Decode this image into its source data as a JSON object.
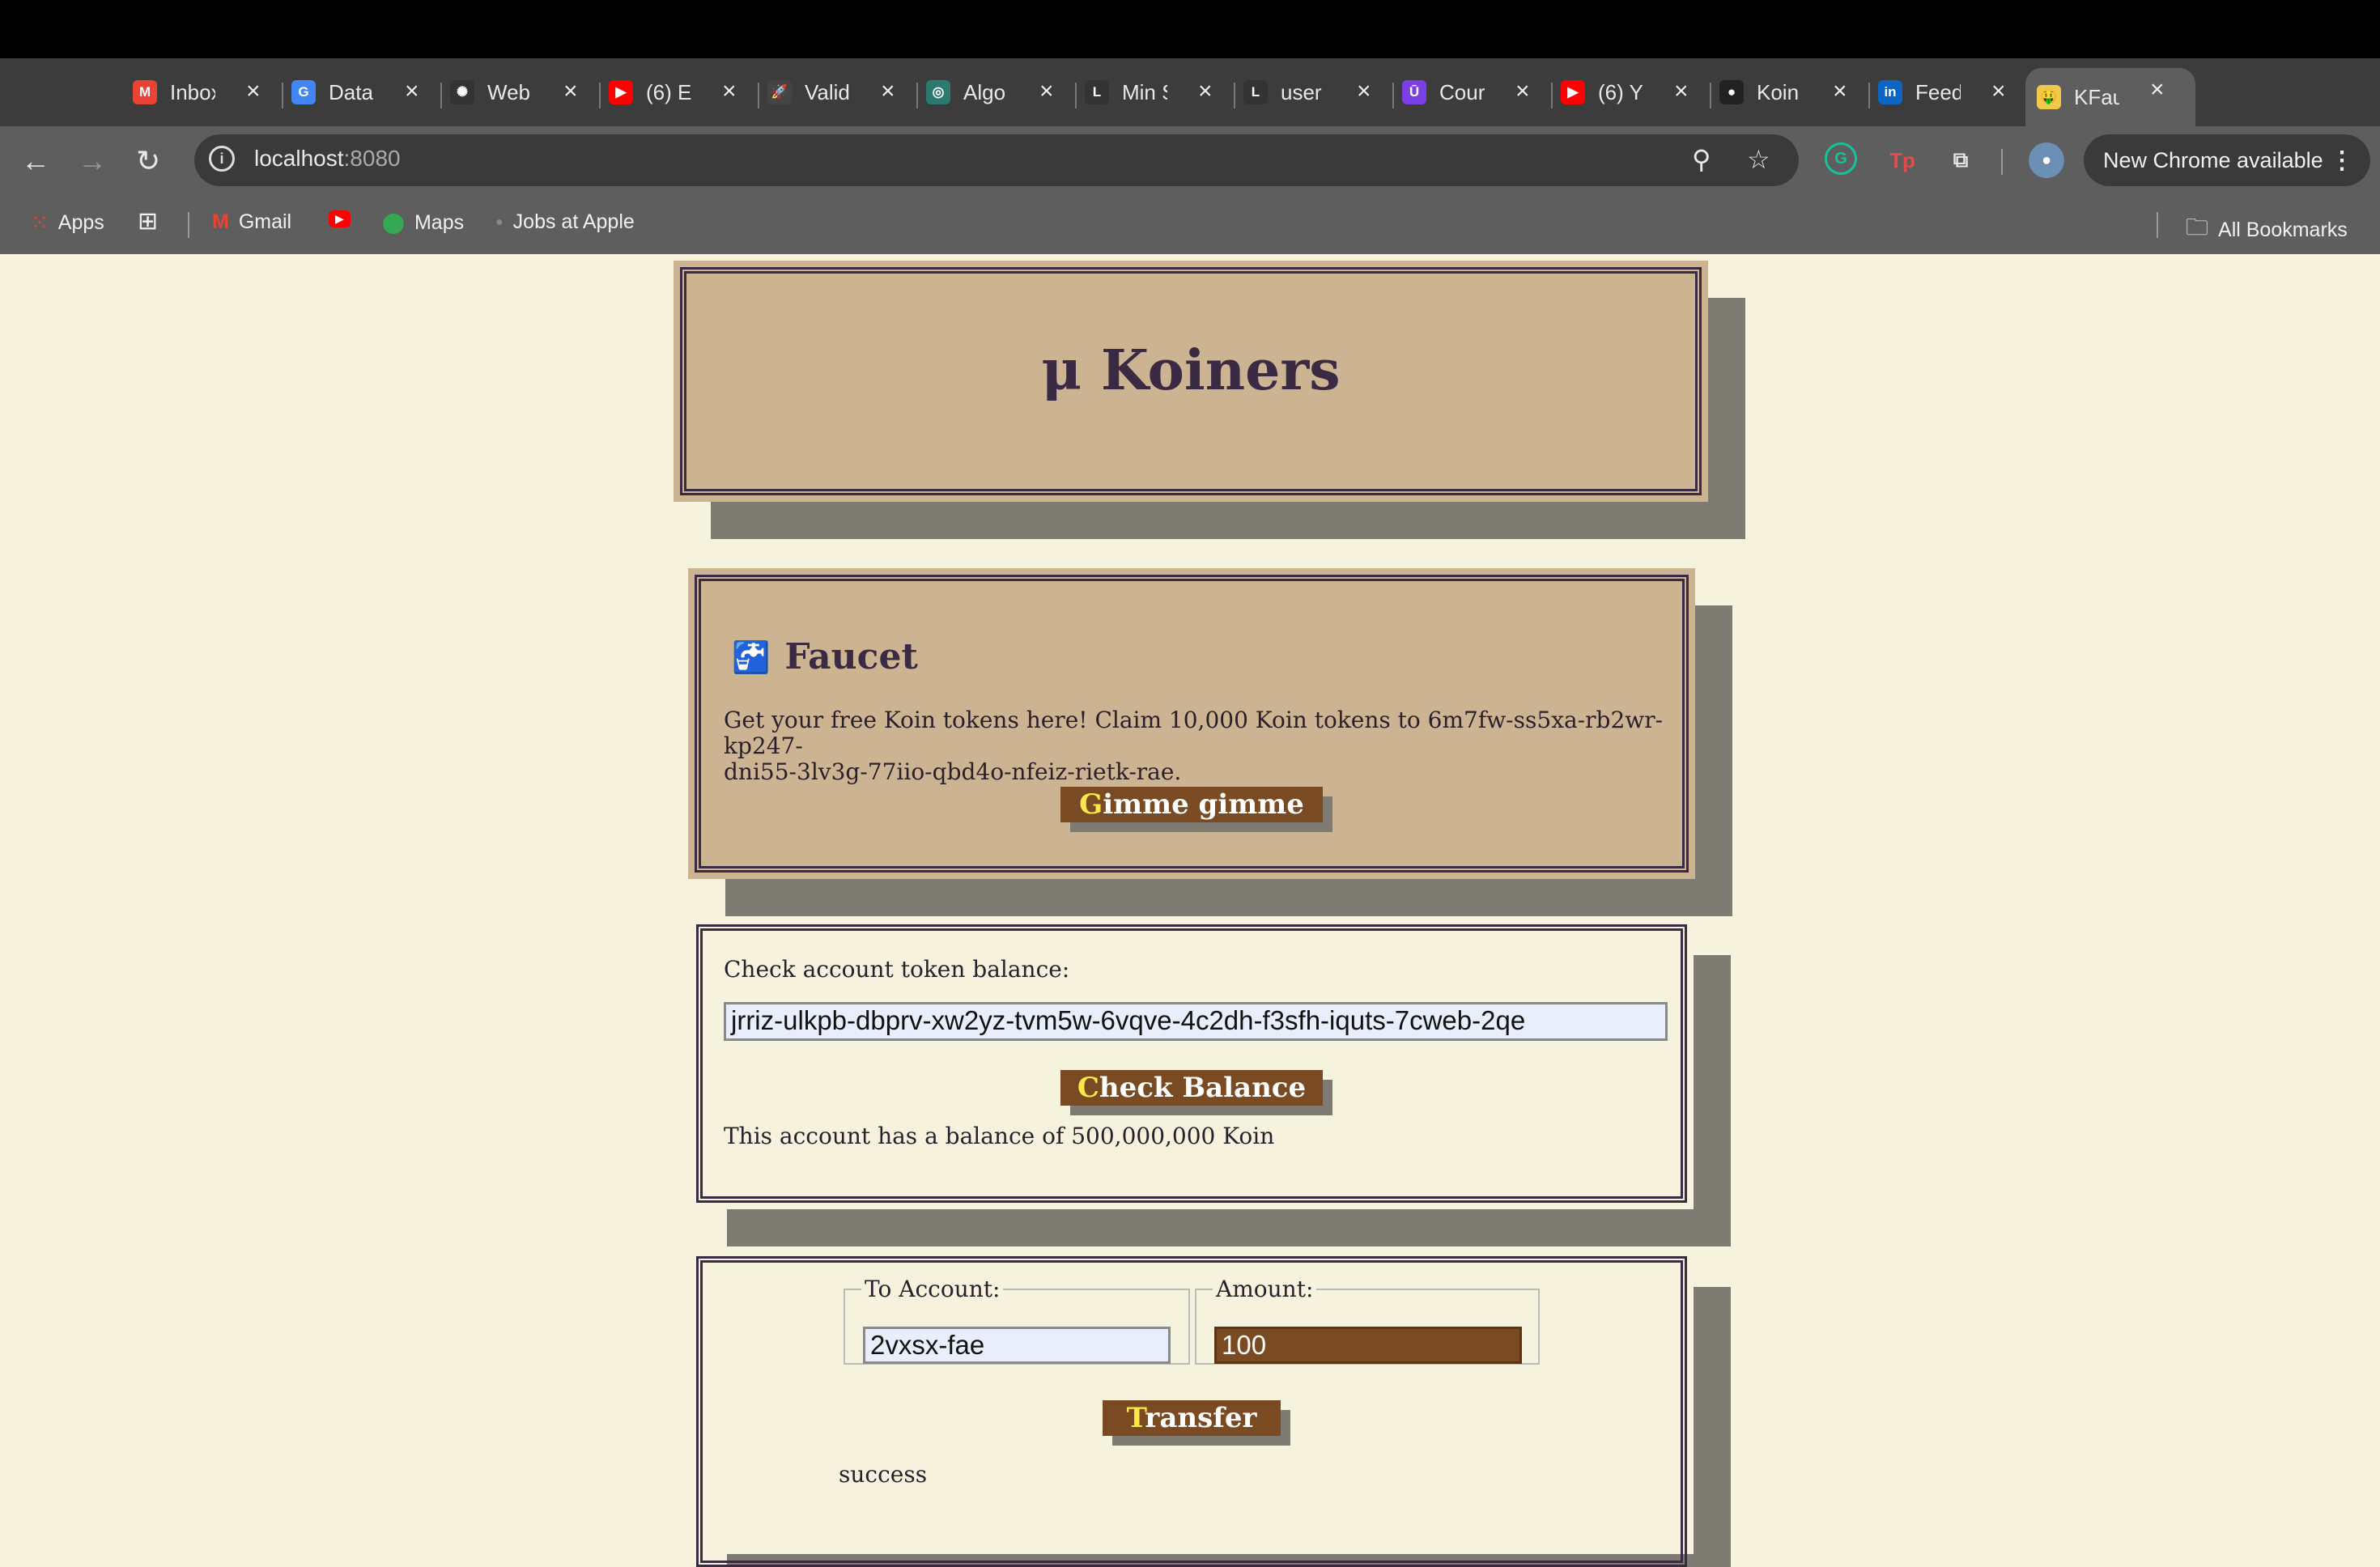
{
  "browser": {
    "tabs": [
      {
        "title": "Inbox",
        "icon": "gmail-icon",
        "color": "#ea4335",
        "glyph": "M"
      },
      {
        "title": "Data",
        "icon": "google-icon",
        "color": "#4285f4",
        "glyph": "G"
      },
      {
        "title": "Web",
        "icon": "openai-icon",
        "color": "#333333",
        "glyph": "✺"
      },
      {
        "title": "(6) E",
        "icon": "youtube-icon",
        "color": "#ff0000",
        "glyph": "▶"
      },
      {
        "title": "Valid",
        "icon": "rocket-icon",
        "color": "#444444",
        "glyph": "🚀"
      },
      {
        "title": "Algo",
        "icon": "algo-icon",
        "color": "#2a7a6f",
        "glyph": "◎"
      },
      {
        "title": "Min S",
        "icon": "leetcode-icon",
        "color": "#333333",
        "glyph": "L"
      },
      {
        "title": "user",
        "icon": "leetcode-icon",
        "color": "#333333",
        "glyph": "L"
      },
      {
        "title": "Cour",
        "icon": "udemy-icon",
        "color": "#7b3fe4",
        "glyph": "Ū"
      },
      {
        "title": "(6) Y",
        "icon": "youtube-icon",
        "color": "#ff0000",
        "glyph": "▶"
      },
      {
        "title": "Koin",
        "icon": "github-icon",
        "color": "#222222",
        "glyph": "●"
      },
      {
        "title": "Feed",
        "icon": "linkedin-icon",
        "color": "#0a66c2",
        "glyph": "in"
      },
      {
        "title": "KFau",
        "icon": "money-face-icon",
        "color": "#f2c94c",
        "glyph": "🤑"
      }
    ],
    "url_host": "localhost",
    "url_port": ":8080",
    "new_chrome": "New Chrome available",
    "bookmarks": {
      "apps": "Apps",
      "gmail": "Gmail",
      "maps": "Maps",
      "jobs": "Jobs at Apple",
      "all": "All Bookmarks"
    }
  },
  "page": {
    "title": "μ Koiners",
    "faucet": {
      "icon": "🚰",
      "heading": "Faucet",
      "text_line1": "Get your free Koin tokens here! Claim 10,000 Koin tokens to 6m7fw-ss5xa-rb2wr-kp247-",
      "text_line2": "dni55-3lv3g-77iio-qbd4o-nfeiz-rietk-rae.",
      "button_first": "G",
      "button_rest": "imme gimme"
    },
    "balance": {
      "label": "Check account token balance:",
      "account_value": "jrriz-ulkpb-dbprv-xw2yz-tvm5w-6vqve-4c2dh-f3sfh-iquts-7cweb-2qe",
      "button_first": "C",
      "button_rest": "heck Balance",
      "result": "This account has a balance of 500,000,000 Koin"
    },
    "transfer": {
      "to_legend": "To Account:",
      "to_value": "2vxsx-fae",
      "amount_legend": "Amount:",
      "amount_value": "100",
      "button_first": "T",
      "button_rest": "ransfer",
      "status": "success"
    }
  },
  "colors": {
    "page_bg": "#f5f3de",
    "panel_bg": "#ccb492",
    "border": "#3b2a44",
    "button_bg": "#7a4a22",
    "button_accent": "#ffe94a",
    "shadow": "#7d7b72"
  }
}
